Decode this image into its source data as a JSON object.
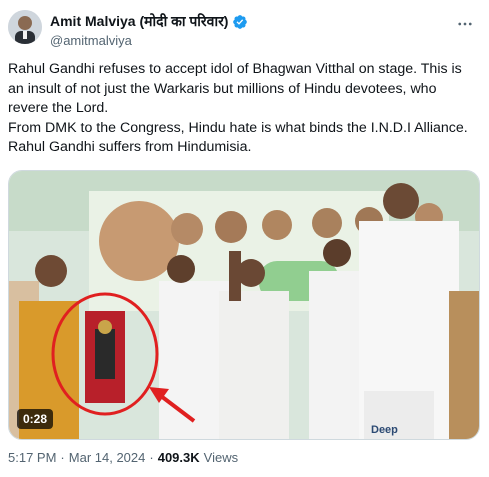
{
  "author": {
    "display_name": "Amit Malviya (मोदी का परिवार)",
    "handle": "@amitmalviya",
    "verified": true,
    "verified_color": "#1d9bf0"
  },
  "more_icon": "more-horizontal-icon",
  "tweet": {
    "lines": [
      "Rahul Gandhi refuses to accept idol of Bhagwan Vitthal on stage. This is an insult of not just the Warkaris but millions of Hindu devotees, who revere the Lord.",
      "From DMK to the Congress, Hindu hate is what binds the I.N.D.I Alliance.",
      "Rahul Gandhi suffers from Hindumisia."
    ]
  },
  "media": {
    "duration": "0:28",
    "podium_text": "Deep",
    "annotation_color": "#e02020"
  },
  "meta": {
    "time": "5:17 PM",
    "separator": "·",
    "date": "Mar 14, 2024",
    "views_count": "409.3K",
    "views_label": "Views"
  }
}
